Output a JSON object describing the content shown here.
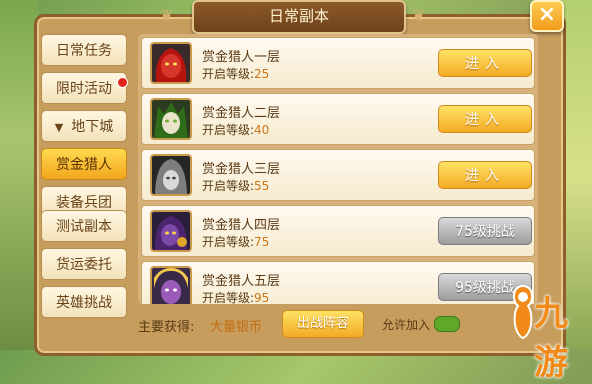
{
  "dialog": {
    "title": "日常副本",
    "close_label": "×"
  },
  "sidebar": {
    "items": [
      {
        "label": "日常任务"
      },
      {
        "label": "限时活动"
      },
      {
        "label": "地下城"
      },
      {
        "label": "赏金猎人"
      },
      {
        "label": "装备兵团"
      },
      {
        "label": "测试副本"
      },
      {
        "label": "货运委托"
      },
      {
        "label": "英雄挑战"
      }
    ],
    "active_index": 3
  },
  "dungeons": [
    {
      "name": "赏金猎人一层",
      "level_label": "开启等级:",
      "level": "25",
      "button": "进入",
      "state": "enter",
      "avatar_color": "#d7372a",
      "hair_color": "#b5140f"
    },
    {
      "name": "赏金猎人二层",
      "level_label": "开启等级:",
      "level": "40",
      "button": "进入",
      "state": "enter",
      "avatar_color": "#6fae3b",
      "hair_color": "#2f6b18"
    },
    {
      "name": "赏金猎人三层",
      "level_label": "开启等级:",
      "level": "55",
      "button": "进入",
      "state": "enter",
      "avatar_color": "#c9c9c9",
      "hair_color": "#7e7e7e"
    },
    {
      "name": "赏金猎人四层",
      "level_label": "开启等级:",
      "level": "75",
      "button": "75级挑战",
      "state": "locked",
      "avatar_color": "#7b4aa8",
      "hair_color": "#4b2470"
    },
    {
      "name": "赏金猎人五层",
      "level_label": "开启等级:",
      "level": "95",
      "button": "95级挑战",
      "state": "locked",
      "avatar_color": "#9a5ab8",
      "hair_color": "#f2c84a"
    }
  ],
  "bottom": {
    "reward_label": "主要获得:",
    "reward_value": "大量银币",
    "formation_button": "出战阵容",
    "allow_label": "允许加入"
  },
  "watermark": {
    "text": "九游"
  }
}
